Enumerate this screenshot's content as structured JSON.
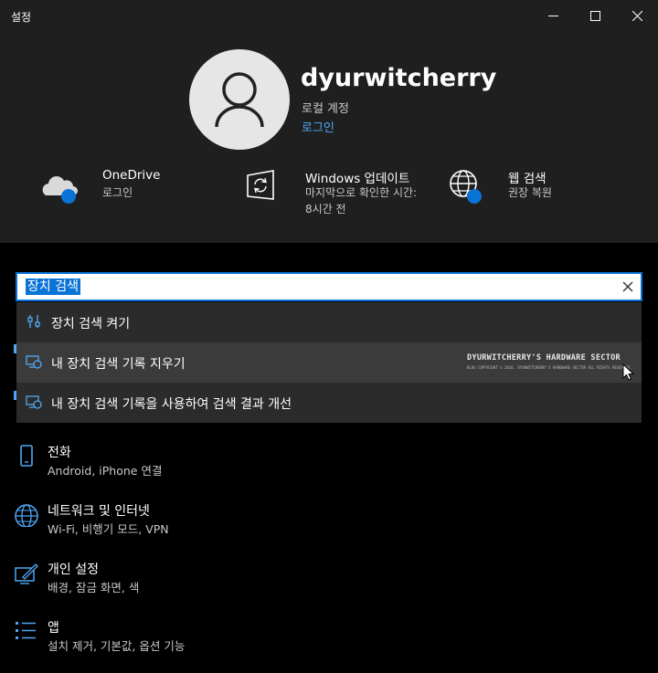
{
  "window": {
    "title": "설정"
  },
  "account": {
    "username": "dyurwitcherry",
    "type": "로컬 계정",
    "login_link": "로그인"
  },
  "quick_items": [
    {
      "title": "OneDrive",
      "subtitle": "로그인",
      "icon": "onedrive-icon"
    },
    {
      "title": "Windows 업데이트",
      "subtitle": "마지막으로 확인한 시간: 8시간 전",
      "icon": "windows-update-icon"
    },
    {
      "title": "웹 검색",
      "subtitle": "권장 복원",
      "icon": "web-search-icon"
    }
  ],
  "search": {
    "value": "장치 검색"
  },
  "suggestions": [
    {
      "label": "장치 검색 켜기",
      "icon": "settings-sliders-icon"
    },
    {
      "label": "내 장치 검색 기록 지우기",
      "icon": "device-history-icon"
    },
    {
      "label": "내 장치 검색 기록을 사용하여 검색 결과 개선",
      "icon": "device-history-icon"
    }
  ],
  "watermark": {
    "title": "DYURWITCHERRY'S HARDWARE SECTOR",
    "subtitle": "BLOG COPYRIGHT © 2018. DYURWITCHERRY'S HARDWARE SECTOR ALL RIGHTS RESERVED."
  },
  "categories": [
    {
      "title": "전화",
      "subtitle": "Android, iPhone 연결",
      "icon": "phone-icon"
    },
    {
      "title": "네트워크 및 인터넷",
      "subtitle": "Wi-Fi, 비행기 모드, VPN",
      "icon": "globe-icon"
    },
    {
      "title": "개인 설정",
      "subtitle": "배경, 잠금 화면, 색",
      "icon": "personalization-icon"
    },
    {
      "title": "앱",
      "subtitle": "설치 제거, 기본값, 옵션 기능",
      "icon": "apps-list-icon"
    }
  ],
  "colors": {
    "accent": "#0a74d6",
    "link": "#4ea8f5",
    "header_bg": "#1f1f1f",
    "dropdown_bg": "#2b2b2b",
    "dropdown_hover": "#3b3b3b"
  }
}
